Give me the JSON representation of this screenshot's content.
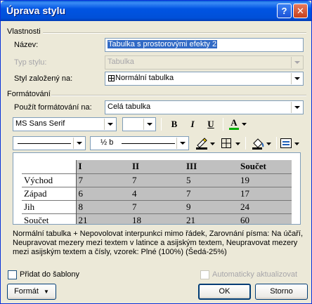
{
  "window": {
    "title": "Úprava stylu",
    "help": "?",
    "close": "✕"
  },
  "properties": {
    "group_label": "Vlastnosti",
    "name_label": "Název:",
    "name_value": "Tabulka s prostorovými efekty 2",
    "type_label": "Typ stylu:",
    "type_value": "Tabulka",
    "based_label": "Styl založený na:",
    "based_value": "Normální tabulka",
    "based_icon": "table-icon"
  },
  "formatting": {
    "group_label": "Formátování",
    "apply_label": "Použít formátování na:",
    "apply_value": "Celá tabulka",
    "font_value": "MS Sans Serif",
    "size_value": "",
    "bold": "B",
    "italic": "I",
    "underline": "U",
    "font_color_glyph": "A",
    "font_color": "#00b000",
    "line_weight_value": "½ b",
    "border_color": "#000000",
    "shading_color": "#000000"
  },
  "preview": {
    "rows": [
      [
        "",
        "I",
        "II",
        "III",
        "Součet"
      ],
      [
        "Východ",
        "7",
        "7",
        "5",
        "19"
      ],
      [
        "Západ",
        "6",
        "4",
        "7",
        "17"
      ],
      [
        "Jih",
        "8",
        "7",
        "9",
        "24"
      ],
      [
        "Součet",
        "21",
        "18",
        "21",
        "60"
      ]
    ]
  },
  "description": "Normální tabulka + Nepovolovat interpunkci mimo řádek, Zarovnání písma: Na účaří, Neupravovat mezery mezi textem v latince a asijským textem, Neupravovat mezery mezi asijským textem a čísly, vzorek: Plné (100%) (Šedá-25%)",
  "footer": {
    "add_to_template": "Přidat do šablony",
    "auto_update": "Automaticky aktualizovat",
    "format_button": "Formát",
    "ok_button": "OK",
    "cancel_button": "Storno"
  }
}
